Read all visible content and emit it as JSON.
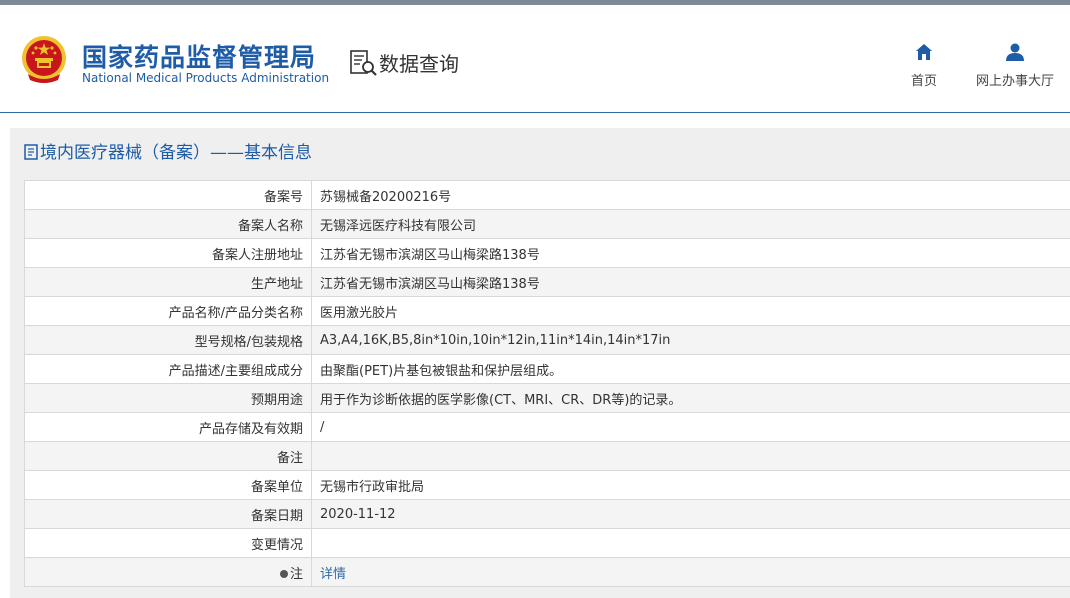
{
  "header": {
    "org_name_cn": "国家药品监督管理局",
    "org_name_en": "National Medical Products Administration",
    "section_title": "数据查询",
    "nav": [
      {
        "label": "首页",
        "icon": "home-icon"
      },
      {
        "label": "网上办事大厅",
        "icon": "user-icon"
      }
    ]
  },
  "panel": {
    "title": "境内医疗器械（备案）——基本信息"
  },
  "rows": [
    {
      "label": "备案号",
      "value": "苏锡械备20200216号"
    },
    {
      "label": "备案人名称",
      "value": "无锡泽远医疗科技有限公司"
    },
    {
      "label": "备案人注册地址",
      "value": "江苏省无锡市滨湖区马山梅梁路138号"
    },
    {
      "label": "生产地址",
      "value": "江苏省无锡市滨湖区马山梅梁路138号"
    },
    {
      "label": "产品名称/产品分类名称",
      "value": "医用激光胶片"
    },
    {
      "label": "型号规格/包装规格",
      "value": "A3,A4,16K,B5,8in*10in,10in*12in,11in*14in,14in*17in"
    },
    {
      "label": "产品描述/主要组成成分",
      "value": "由聚酯(PET)片基包被银盐和保护层组成。"
    },
    {
      "label": "预期用途",
      "value": "用于作为诊断依据的医学影像(CT、MRI、CR、DR等)的记录。"
    },
    {
      "label": "产品存储及有效期",
      "value": "/"
    },
    {
      "label": "备注",
      "value": ""
    },
    {
      "label": "备案单位",
      "value": "无锡市行政审批局"
    },
    {
      "label": "备案日期",
      "value": "2020-11-12"
    },
    {
      "label": "变更情况",
      "value": ""
    },
    {
      "label": "注",
      "value": "详情"
    }
  ],
  "colors": {
    "brand_blue": "#1e5ca8",
    "link_blue": "#2f6aa6",
    "emblem_red": "#c8161d",
    "emblem_gold": "#f2c12e"
  }
}
